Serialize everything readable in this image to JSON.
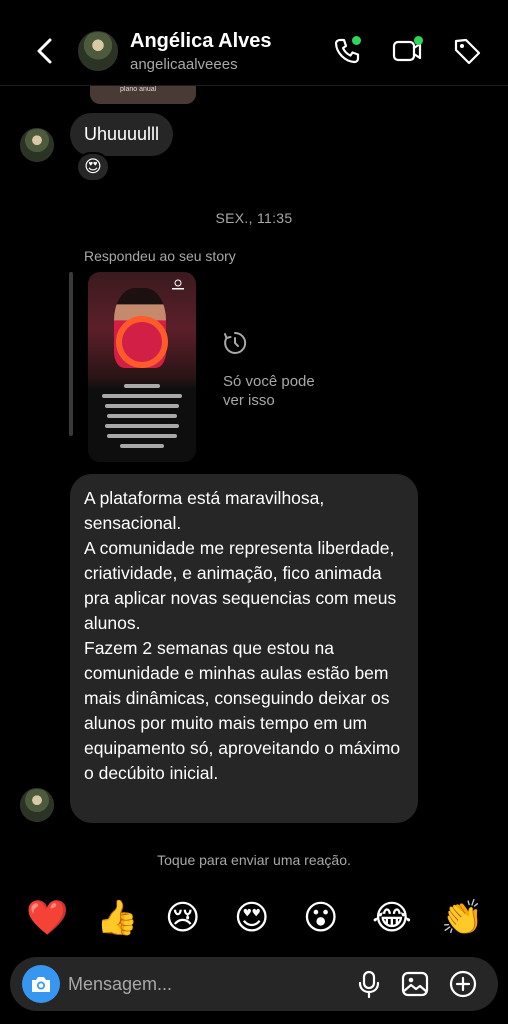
{
  "header": {
    "name": "Angélica Alves",
    "handle": "angelicaalveees"
  },
  "chat": {
    "prev_card_text": "plano anual",
    "short_message": "Uhuuuulll",
    "short_reaction": "😍",
    "timestamp": "SEX., 11:35",
    "replied_label": "Respondeu ao seu story",
    "only_you_text": "Só você pode ver isso",
    "long_message": {
      "p1": "A plataforma está maravilhosa, sensacional.",
      "p2": "A comunidade me representa liberdade, criatividade, e animação, fico animada pra aplicar novas sequencias com meus alunos.",
      "p3": "Fazem 2 semanas que estou na comunidade e minhas aulas estão bem mais dinâmicas, conseguindo deixar os alunos por muito mais tempo em um equipamento só, aproveitando o máximo o decúbito inicial."
    },
    "tap_hint": "Toque para enviar uma reação."
  },
  "quick_reactions": [
    "❤️",
    "👍",
    "😢",
    "😍",
    "😮",
    "😂",
    "👏"
  ],
  "composer": {
    "placeholder": "Mensagem..."
  },
  "colors": {
    "background": "#000000",
    "bubble": "#262626",
    "muted_text": "#a8a8a8",
    "accent_blue": "#3797f0",
    "online_green": "#2fd65a"
  },
  "icons": [
    "chevron-left-icon",
    "phone-icon",
    "video-camera-icon",
    "tag-icon",
    "timer-icon",
    "camera-icon",
    "microphone-icon",
    "image-icon",
    "plus-circle-icon"
  ]
}
